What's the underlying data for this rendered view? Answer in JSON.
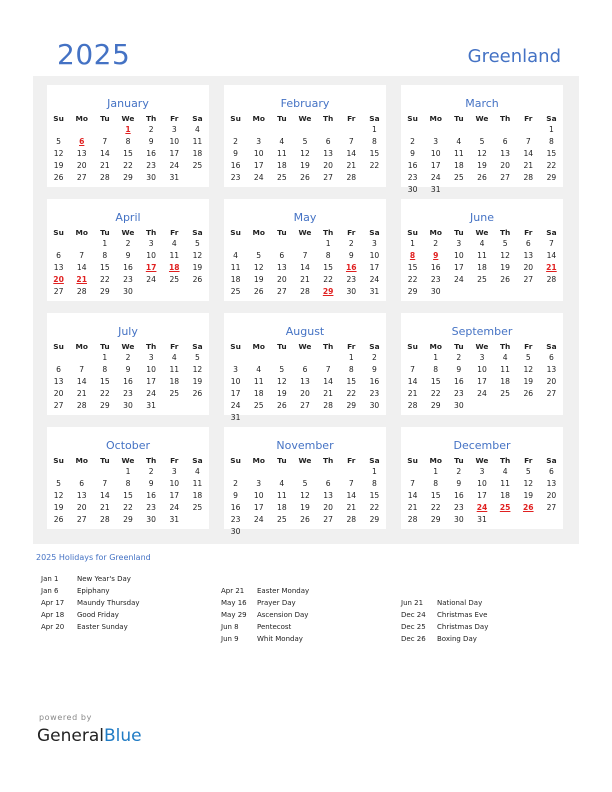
{
  "header": {
    "year": "2025",
    "country": "Greenland"
  },
  "weekdays": [
    "Su",
    "Mo",
    "Tu",
    "We",
    "Th",
    "Fr",
    "Sa"
  ],
  "months": [
    {
      "name": "January",
      "start": 3,
      "days": 31,
      "holidays": [
        1,
        6
      ]
    },
    {
      "name": "February",
      "start": 6,
      "days": 28,
      "holidays": []
    },
    {
      "name": "March",
      "start": 6,
      "days": 31,
      "holidays": []
    },
    {
      "name": "April",
      "start": 2,
      "days": 30,
      "holidays": [
        17,
        18,
        20,
        21
      ]
    },
    {
      "name": "May",
      "start": 4,
      "days": 31,
      "holidays": [
        16,
        29
      ]
    },
    {
      "name": "June",
      "start": 0,
      "days": 30,
      "holidays": [
        8,
        9,
        21
      ]
    },
    {
      "name": "July",
      "start": 2,
      "days": 31,
      "holidays": []
    },
    {
      "name": "August",
      "start": 5,
      "days": 31,
      "holidays": []
    },
    {
      "name": "September",
      "start": 1,
      "days": 30,
      "holidays": []
    },
    {
      "name": "October",
      "start": 3,
      "days": 31,
      "holidays": []
    },
    {
      "name": "November",
      "start": 6,
      "days": 30,
      "holidays": []
    },
    {
      "name": "December",
      "start": 1,
      "days": 31,
      "holidays": [
        24,
        25,
        26
      ]
    }
  ],
  "holidays_title": "2025 Holidays for Greenland",
  "holiday_columns": [
    [
      {
        "date": "Jan 1",
        "name": "New Year's Day"
      },
      {
        "date": "Jan 6",
        "name": "Epiphany"
      },
      {
        "date": "Apr 17",
        "name": "Maundy Thursday"
      },
      {
        "date": "Apr 18",
        "name": "Good Friday"
      },
      {
        "date": "Apr 20",
        "name": "Easter Sunday"
      }
    ],
    [
      {
        "date": "Apr 21",
        "name": "Easter Monday"
      },
      {
        "date": "May 16",
        "name": "Prayer Day"
      },
      {
        "date": "May 29",
        "name": "Ascension Day"
      },
      {
        "date": "Jun 8",
        "name": "Pentecost"
      },
      {
        "date": "Jun 9",
        "name": "Whit Monday"
      }
    ],
    [
      {
        "date": "Jun 21",
        "name": "National Day"
      },
      {
        "date": "Dec 24",
        "name": "Christmas Eve"
      },
      {
        "date": "Dec 25",
        "name": "Christmas Day"
      },
      {
        "date": "Dec 26",
        "name": "Boxing Day"
      }
    ]
  ],
  "footer": {
    "powered_by": "powered by",
    "brand_general": "General",
    "brand_blue": "Blue"
  }
}
